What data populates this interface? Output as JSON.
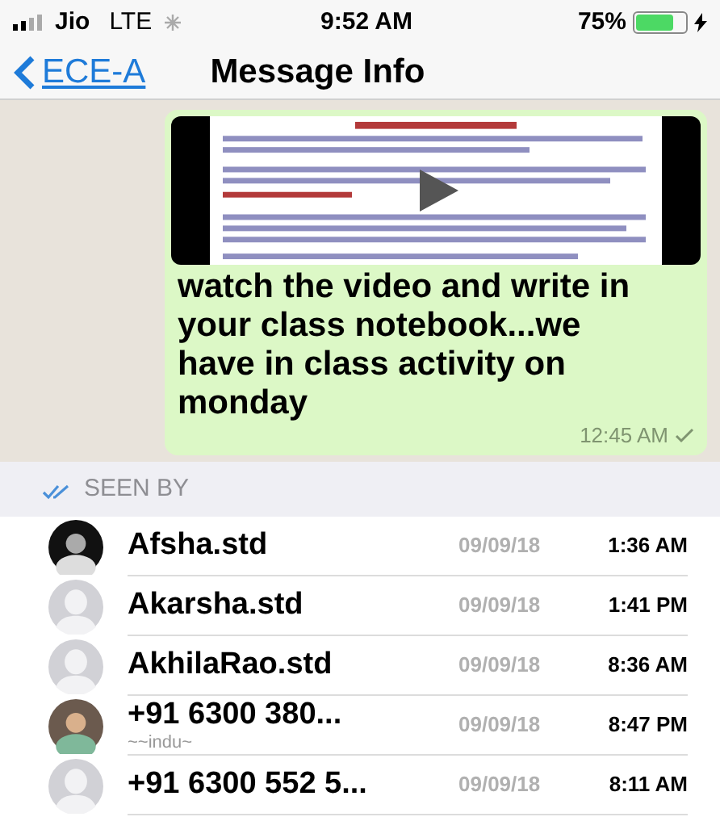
{
  "status_bar": {
    "carrier": "Jio",
    "network": "LTE",
    "time": "9:52 AM",
    "battery": "75%"
  },
  "nav": {
    "back": "ECE-A",
    "title": "Message Info"
  },
  "message": {
    "text": "watch the video and write in your class notebook...we have in class activity on monday",
    "time": "12:45 AM",
    "read": true
  },
  "seen_by": {
    "label": "SEEN BY",
    "rows": [
      {
        "name": "Afsha.std",
        "date": "09/09/18",
        "time": "1:36 AM"
      },
      {
        "name": "Akarsha.std",
        "date": "09/09/18",
        "time": "1:41 PM",
        "kind": "placeholder"
      },
      {
        "name": "AkhilaRao.std",
        "date": "09/09/18",
        "time": "8:36 AM",
        "kind": "placeholder"
      },
      {
        "name": "+91 6300 380...",
        "subtitle": "~~indu~",
        "date": "09/09/18",
        "time": "8:47 PM"
      },
      {
        "name": "+91 6300 552 5...",
        "date": "09/09/18",
        "time": "8:11 AM",
        "kind": "placeholder"
      }
    ]
  }
}
